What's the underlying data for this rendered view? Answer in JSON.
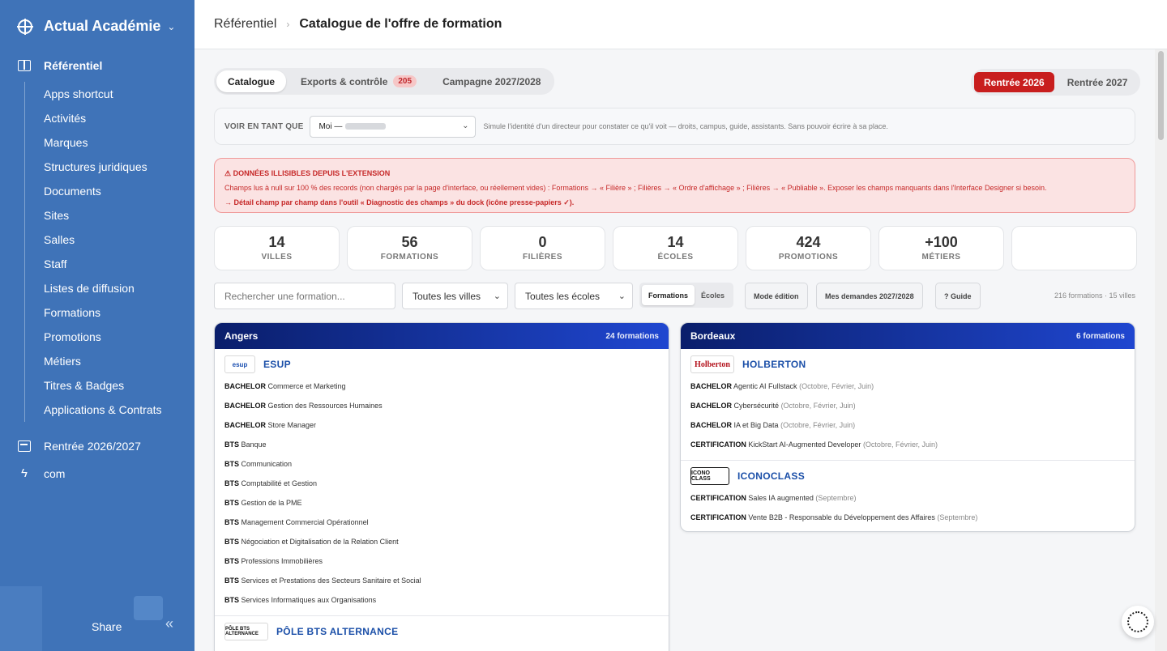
{
  "sidebar": {
    "brand": "Actual Académie",
    "section_referentiel": "Référentiel",
    "items": [
      "Apps shortcut",
      "Activités",
      "Marques",
      "Structures juridiques",
      "Documents",
      "Sites",
      "Salles",
      "Staff",
      "Listes de diffusion",
      "Formations",
      "Promotions",
      "Métiers",
      "Titres & Badges",
      "Applications & Contrats"
    ],
    "section_rentree": "Rentrée 2026/2027",
    "section_com": "com",
    "share": "Share"
  },
  "breadcrumb": {
    "parent": "Référentiel",
    "current": "Catalogue de l'offre de formation"
  },
  "tabs": {
    "catalogue": "Catalogue",
    "exports": "Exports & contrôle",
    "exports_badge": "205",
    "campagne": "Campagne 2027/2028"
  },
  "rentree": {
    "r2026": "Rentrée 2026",
    "r2027": "Rentrée 2027",
    "accent": "#c81e1e"
  },
  "voir": {
    "label": "VOIR EN TANT QUE",
    "select_value": "Moi —",
    "hint": "Simule l'identité d'un directeur pour constater ce qu'il voit — droits, campus, guide, assistants. Sans pouvoir écrire à sa place."
  },
  "alert": {
    "title": "⚠ DONNÉES ILLISIBLES DEPUIS L'EXTENSION",
    "body": "Champs lus à null sur 100 % des records (non chargés par la page d'interface, ou réellement vides) : Formations → « Filière » ; Filières → « Ordre d'affichage » ; Filières → « Publiable ». Exposer les champs manquants dans l'Interface Designer si besoin.",
    "detail": "→ Détail champ par champ dans l'outil « Diagnostic des champs » du dock (icône presse-papiers ✓)."
  },
  "stats": [
    {
      "num": "14",
      "label": "VILLES"
    },
    {
      "num": "56",
      "label": "FORMATIONS"
    },
    {
      "num": "0",
      "label": "FILIÈRES"
    },
    {
      "num": "14",
      "label": "ÉCOLES"
    },
    {
      "num": "424",
      "label": "PROMOTIONS"
    },
    {
      "num": "+100",
      "label": "MÉTIERS"
    },
    {
      "num": "",
      "label": ""
    }
  ],
  "filters": {
    "search_placeholder": "Rechercher une formation...",
    "villes": "Toutes les villes",
    "ecoles": "Toutes les écoles",
    "seg_formations": "Formations",
    "seg_ecoles": "Écoles",
    "mode_edition": "Mode édition",
    "mes_demandes": "Mes demandes 2027/2028",
    "guide": "? Guide",
    "count": "216 formations · 15 villes"
  },
  "cards": {
    "angers": {
      "city": "Angers",
      "count": "24 formations",
      "esup": {
        "logo": "esup",
        "name": "ESUP",
        "formations": [
          {
            "t": "BACHELOR",
            "n": "Commerce et Marketing"
          },
          {
            "t": "BACHELOR",
            "n": "Gestion des Ressources Humaines"
          },
          {
            "t": "BACHELOR",
            "n": "Store Manager"
          },
          {
            "t": "BTS",
            "n": "Banque"
          },
          {
            "t": "BTS",
            "n": "Communication"
          },
          {
            "t": "BTS",
            "n": "Comptabilité et Gestion"
          },
          {
            "t": "BTS",
            "n": "Gestion de la PME"
          },
          {
            "t": "BTS",
            "n": "Management Commercial Opérationnel"
          },
          {
            "t": "BTS",
            "n": "Négociation et Digitalisation de la Relation Client"
          },
          {
            "t": "BTS",
            "n": "Professions Immobilières"
          },
          {
            "t": "BTS",
            "n": "Services et Prestations des Secteurs Sanitaire et Social"
          },
          {
            "t": "BTS",
            "n": "Services Informatiques aux Organisations"
          }
        ]
      },
      "pole": {
        "logo": "PÔLE BTS ALTERNANCE",
        "name": "PÔLE BTS ALTERNANCE"
      }
    },
    "bordeaux": {
      "city": "Bordeaux",
      "count": "6 formations",
      "holberton": {
        "logo": "Holberton",
        "name": "HOLBERTON",
        "formations": [
          {
            "t": "BACHELOR",
            "n": "Agentic AI Fullstack",
            "p": "(Octobre, Février, Juin)"
          },
          {
            "t": "BACHELOR",
            "n": "Cybersécurité",
            "p": "(Octobre, Février, Juin)"
          },
          {
            "t": "BACHELOR",
            "n": "IA et Big Data",
            "p": "(Octobre, Février, Juin)"
          },
          {
            "t": "CERTIFICATION",
            "n": "KickStart AI-Augmented Developer",
            "p": "(Octobre, Février, Juin)"
          }
        ]
      },
      "iconoclass": {
        "logo": "ICONO CLASS",
        "name": "ICONOCLASS",
        "formations": [
          {
            "t": "CERTIFICATION",
            "n": "Sales IA augmented",
            "p": "(Septembre)"
          },
          {
            "t": "CERTIFICATION",
            "n": "Vente B2B - Responsable du Développement des Affaires",
            "p": "(Septembre)"
          }
        ]
      }
    }
  }
}
